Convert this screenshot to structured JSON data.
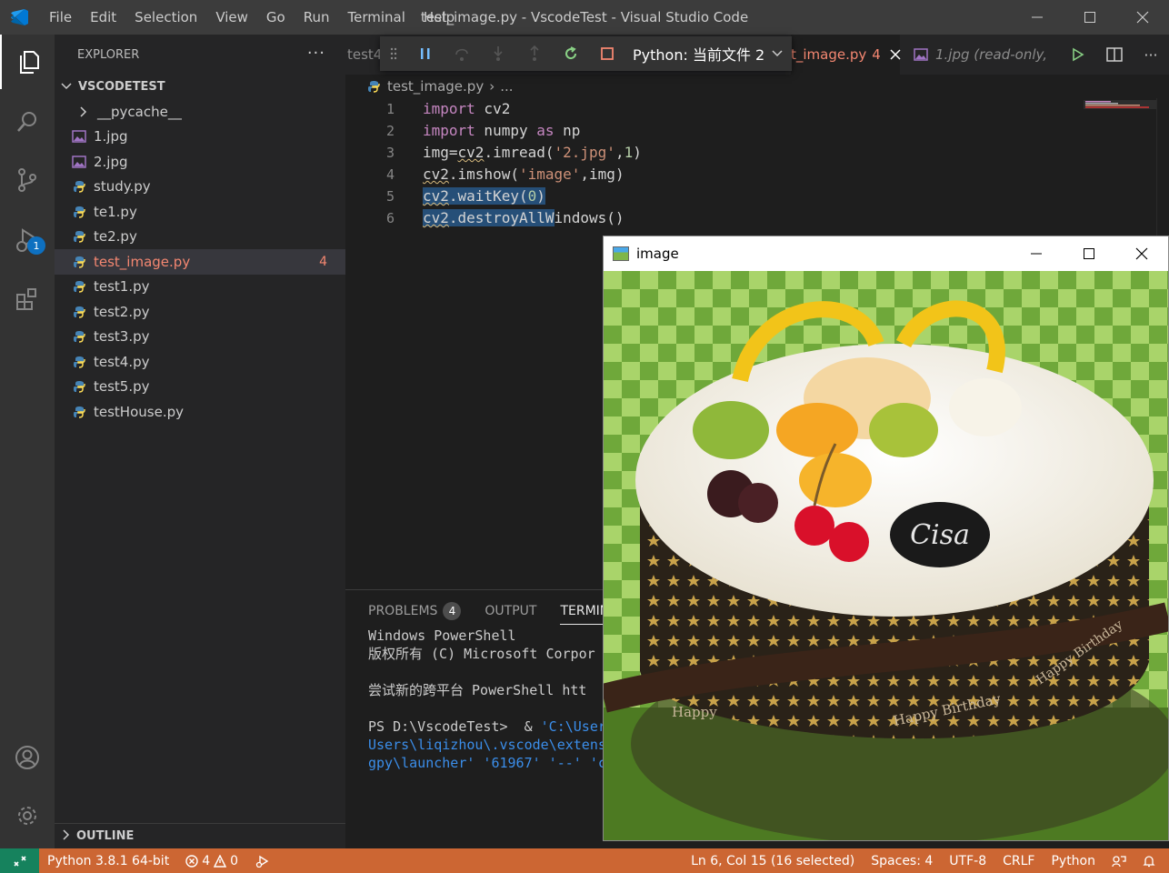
{
  "window": {
    "title": "test_image.py - VscodeTest - Visual Studio Code",
    "menu": [
      "File",
      "Edit",
      "Selection",
      "View",
      "Go",
      "Run",
      "Terminal",
      "Help"
    ]
  },
  "activity": {
    "debug_badge": "1"
  },
  "explorer": {
    "header": "EXPLORER",
    "more": "···",
    "root": "VSCODETEST",
    "folder": "__pycache__",
    "files": [
      {
        "name": "1.jpg",
        "type": "image"
      },
      {
        "name": "2.jpg",
        "type": "image"
      },
      {
        "name": "study.py",
        "type": "python"
      },
      {
        "name": "te1.py",
        "type": "python"
      },
      {
        "name": "te2.py",
        "type": "python"
      },
      {
        "name": "test_image.py",
        "type": "python",
        "problems": "4"
      },
      {
        "name": "test1.py",
        "type": "python"
      },
      {
        "name": "test2.py",
        "type": "python"
      },
      {
        "name": "test3.py",
        "type": "python"
      },
      {
        "name": "test4.py",
        "type": "python"
      },
      {
        "name": "test5.py",
        "type": "python"
      },
      {
        "name": "testHouse.py",
        "type": "python"
      }
    ],
    "outline": "OUTLINE"
  },
  "tabs": {
    "partial": "test4",
    "active": "t_image.py",
    "active_count": "4",
    "other": "1.jpg (read-only,"
  },
  "debug": {
    "config": "Python: 当前文件 2"
  },
  "breadcrumb": {
    "file": "test_image.py",
    "rest": "..."
  },
  "editor": {
    "lines": [
      {
        "n": "1",
        "parts": [
          [
            "kw",
            "import"
          ],
          [
            "t",
            " cv2"
          ]
        ]
      },
      {
        "n": "2",
        "parts": [
          [
            "kw",
            "import"
          ],
          [
            "t",
            " numpy "
          ],
          [
            "kw",
            "as"
          ],
          [
            "t",
            " np"
          ]
        ]
      },
      {
        "n": "3",
        "parts": [
          [
            "t",
            "img="
          ],
          [
            "sq",
            "cv2"
          ],
          [
            "t",
            ".imread("
          ],
          [
            "str",
            "'2.jpg'"
          ],
          [
            "t",
            ","
          ],
          [
            "num",
            "1"
          ],
          [
            "t",
            ")"
          ]
        ]
      },
      {
        "n": "4",
        "parts": [
          [
            "sq",
            "cv2"
          ],
          [
            "t",
            ".imshow("
          ],
          [
            "str",
            "'image'"
          ],
          [
            "t",
            ",img)"
          ]
        ]
      },
      {
        "n": "5",
        "parts": [
          [
            "sqsel",
            "cv2"
          ],
          [
            "sel",
            ".waitKey("
          ],
          [
            "selnum",
            "0"
          ],
          [
            "sel",
            ")"
          ]
        ]
      },
      {
        "n": "6",
        "parts": [
          [
            "sqsel",
            "cv2"
          ],
          [
            "sel",
            ".destroyAllW"
          ],
          [
            "t",
            "indows()"
          ]
        ]
      }
    ]
  },
  "panel": {
    "tabs": [
      "PROBLEMS",
      "OUTPUT",
      "TERMINA"
    ],
    "problems_count": "4",
    "terminal": [
      {
        "cls": "",
        "text": "Windows PowerShell"
      },
      {
        "cls": "",
        "text": "版权所有 (C) Microsoft Corpor"
      },
      {
        "cls": "",
        "text": ""
      },
      {
        "cls": "",
        "text": "尝试新的跨平台 PowerShell htt"
      },
      {
        "cls": "",
        "text": ""
      },
      {
        "cls": "mixed",
        "a": "PS D:\\VscodeTest>  & ",
        "b": "'C:\\User"
      },
      {
        "cls": "blue",
        "text": "Users\\liqizhou\\.vscode\\extens"
      },
      {
        "cls": "blue",
        "text": "gpy\\launcher' '61967' '--' 'c"
      }
    ]
  },
  "image_window": {
    "title": "image",
    "cake_text": "Cisa",
    "ribbon": [
      "Happy Birthday",
      "Happy Birthday",
      "Happy"
    ]
  },
  "status": {
    "interpreter": "Python 3.8.1 64-bit",
    "errors": "4",
    "warnings": "0",
    "position": "Ln 6, Col 15 (16 selected)",
    "spaces": "Spaces: 4",
    "encoding": "UTF-8",
    "eol": "CRLF",
    "language": "Python"
  },
  "colors": {
    "statusbar": "#cc6633",
    "remote": "#16825d",
    "error_file": "#f48771",
    "accent": "#0e70c0"
  }
}
